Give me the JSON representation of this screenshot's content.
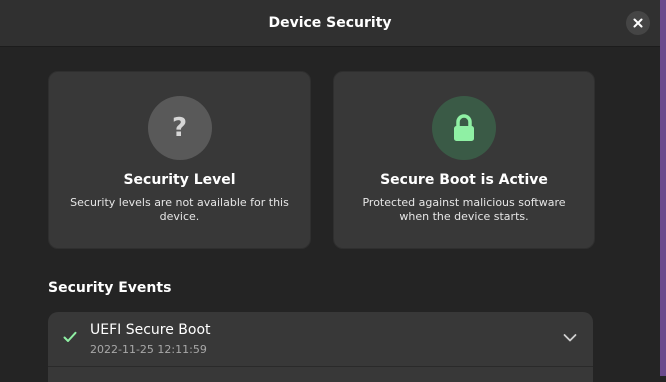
{
  "window": {
    "title": "Device Security"
  },
  "cards": {
    "security_level": {
      "icon": "question-mark-icon",
      "icon_text": "?",
      "title": "Security Level",
      "description": "Security levels are not available for this device."
    },
    "secure_boot": {
      "icon": "lock-icon",
      "title": "Secure Boot is Active",
      "description": "Protected against malicious software when the device starts."
    }
  },
  "events": {
    "heading": "Security Events",
    "items": [
      {
        "title": "UEFI Secure Boot",
        "timestamp": "2022-11-25 12:11:59",
        "status_icon": "check-icon"
      }
    ]
  },
  "colors": {
    "accent_green": "#8ff0a4",
    "background": "#242424",
    "card": "#383838"
  }
}
